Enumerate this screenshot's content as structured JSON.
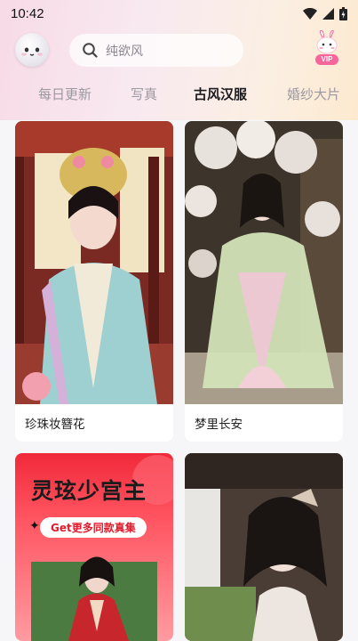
{
  "status_bar": {
    "time": "10:42",
    "icons": [
      "wifi-icon",
      "signal-icon",
      "battery-icon"
    ]
  },
  "header": {
    "avatar_icon": "ghost-avatar-icon",
    "search_placeholder": "纯欲风",
    "search_icon": "search-icon",
    "vip_label": "VIP"
  },
  "tabs": [
    {
      "label": "每日更新",
      "active": false
    },
    {
      "label": "写真",
      "active": false
    },
    {
      "label": "古风汉服",
      "active": true
    },
    {
      "label": "婚纱大片",
      "active": false
    }
  ],
  "cards": [
    {
      "caption": "珍珠妆簪花"
    },
    {
      "caption": "梦里长安"
    },
    {
      "banner_title": "灵玹少宫主",
      "banner_subtitle": "Get更多同款真集"
    },
    {
      "caption": ""
    }
  ],
  "colors": {
    "accent": "#1c1b1f",
    "inactive_tab": "#9c98a0",
    "banner_red": "#f0293a",
    "vip_pink": "#f6669a"
  }
}
